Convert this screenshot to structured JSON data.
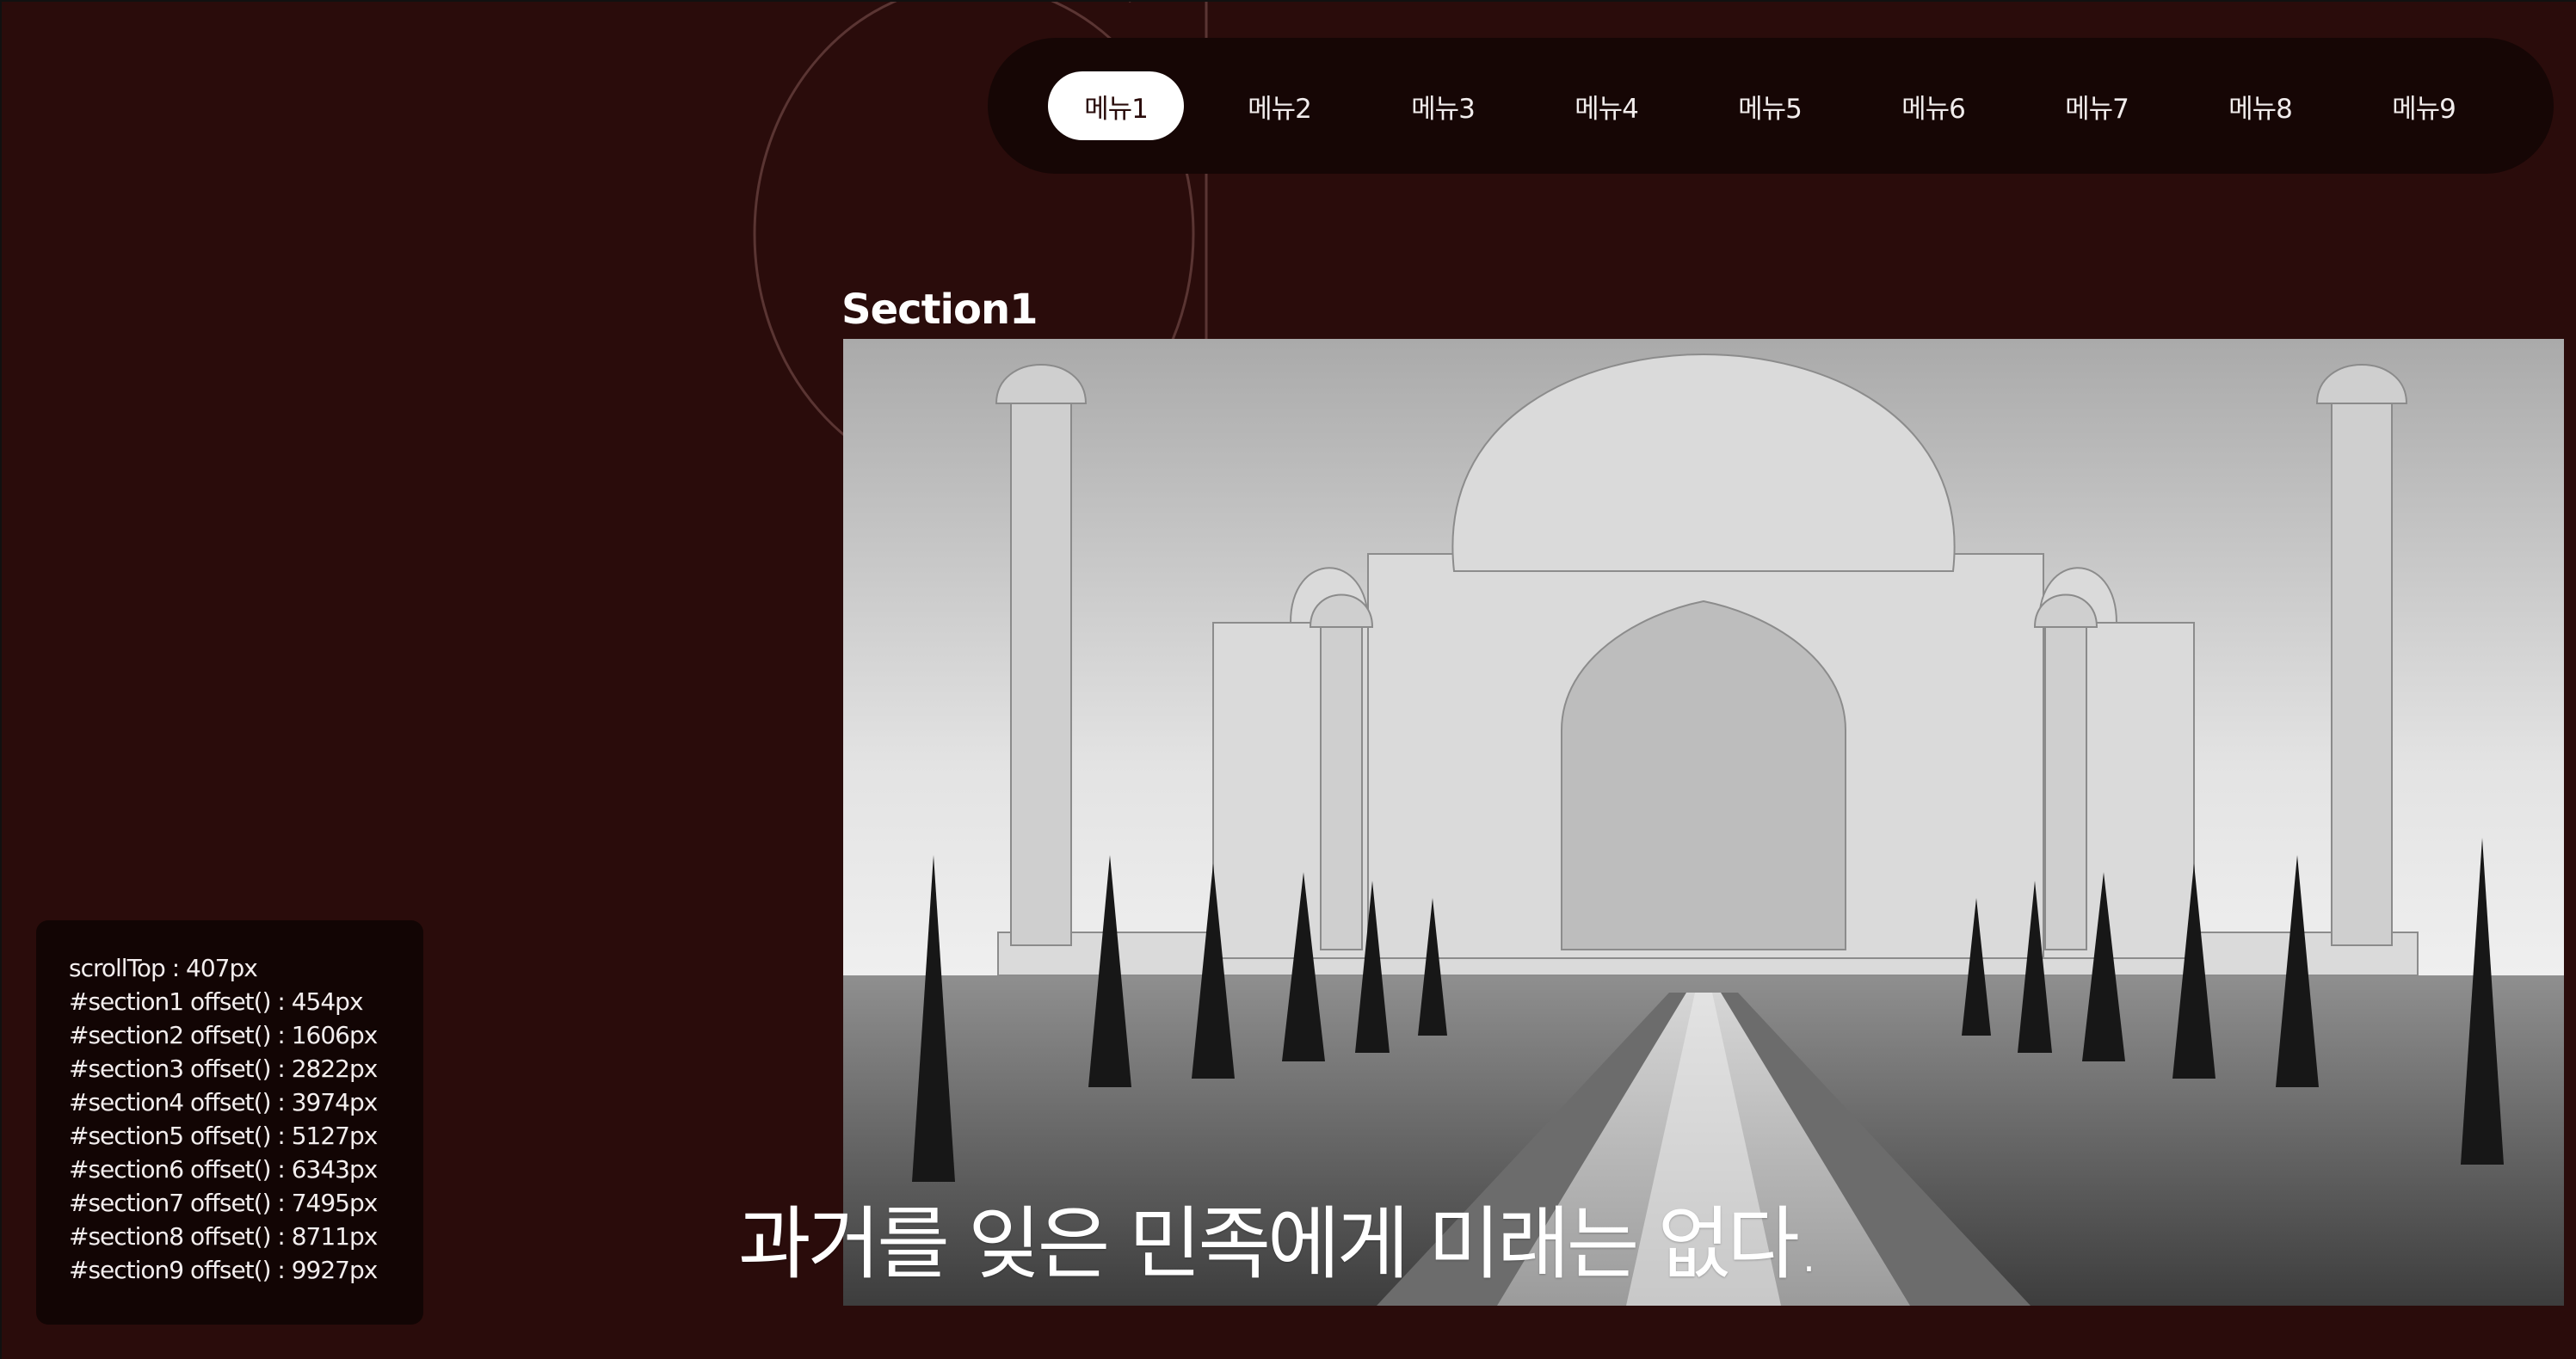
{
  "nav": {
    "items": [
      {
        "label": "메뉴1",
        "active": true
      },
      {
        "label": "메뉴2",
        "active": false
      },
      {
        "label": "메뉴3",
        "active": false
      },
      {
        "label": "메뉴4",
        "active": false
      },
      {
        "label": "메뉴5",
        "active": false
      },
      {
        "label": "메뉴6",
        "active": false
      },
      {
        "label": "메뉴7",
        "active": false
      },
      {
        "label": "메뉴8",
        "active": false
      },
      {
        "label": "메뉴9",
        "active": false
      }
    ]
  },
  "section": {
    "title": "Section1",
    "image_subject": "Taj Mahal black-and-white photo",
    "quote": "과거를 잊은 민족에게 미래는 없다."
  },
  "debug": {
    "lines": [
      "scrollTop : 407px",
      "#section1 offset() : 454px",
      "#section2 offset() : 1606px",
      "#section3 offset() : 2822px",
      "#section4 offset() : 3974px",
      "#section5 offset() : 5127px",
      "#section6 offset() : 6343px",
      "#section7 offset() : 7495px",
      "#section8 offset() : 8711px",
      "#section9 offset() : 9927px"
    ]
  },
  "colors": {
    "background": "#2a0c0b",
    "nav_background": "#160605",
    "active_pill": "#ffffff",
    "debug_panel": "#120504",
    "text": "#ffffff"
  }
}
